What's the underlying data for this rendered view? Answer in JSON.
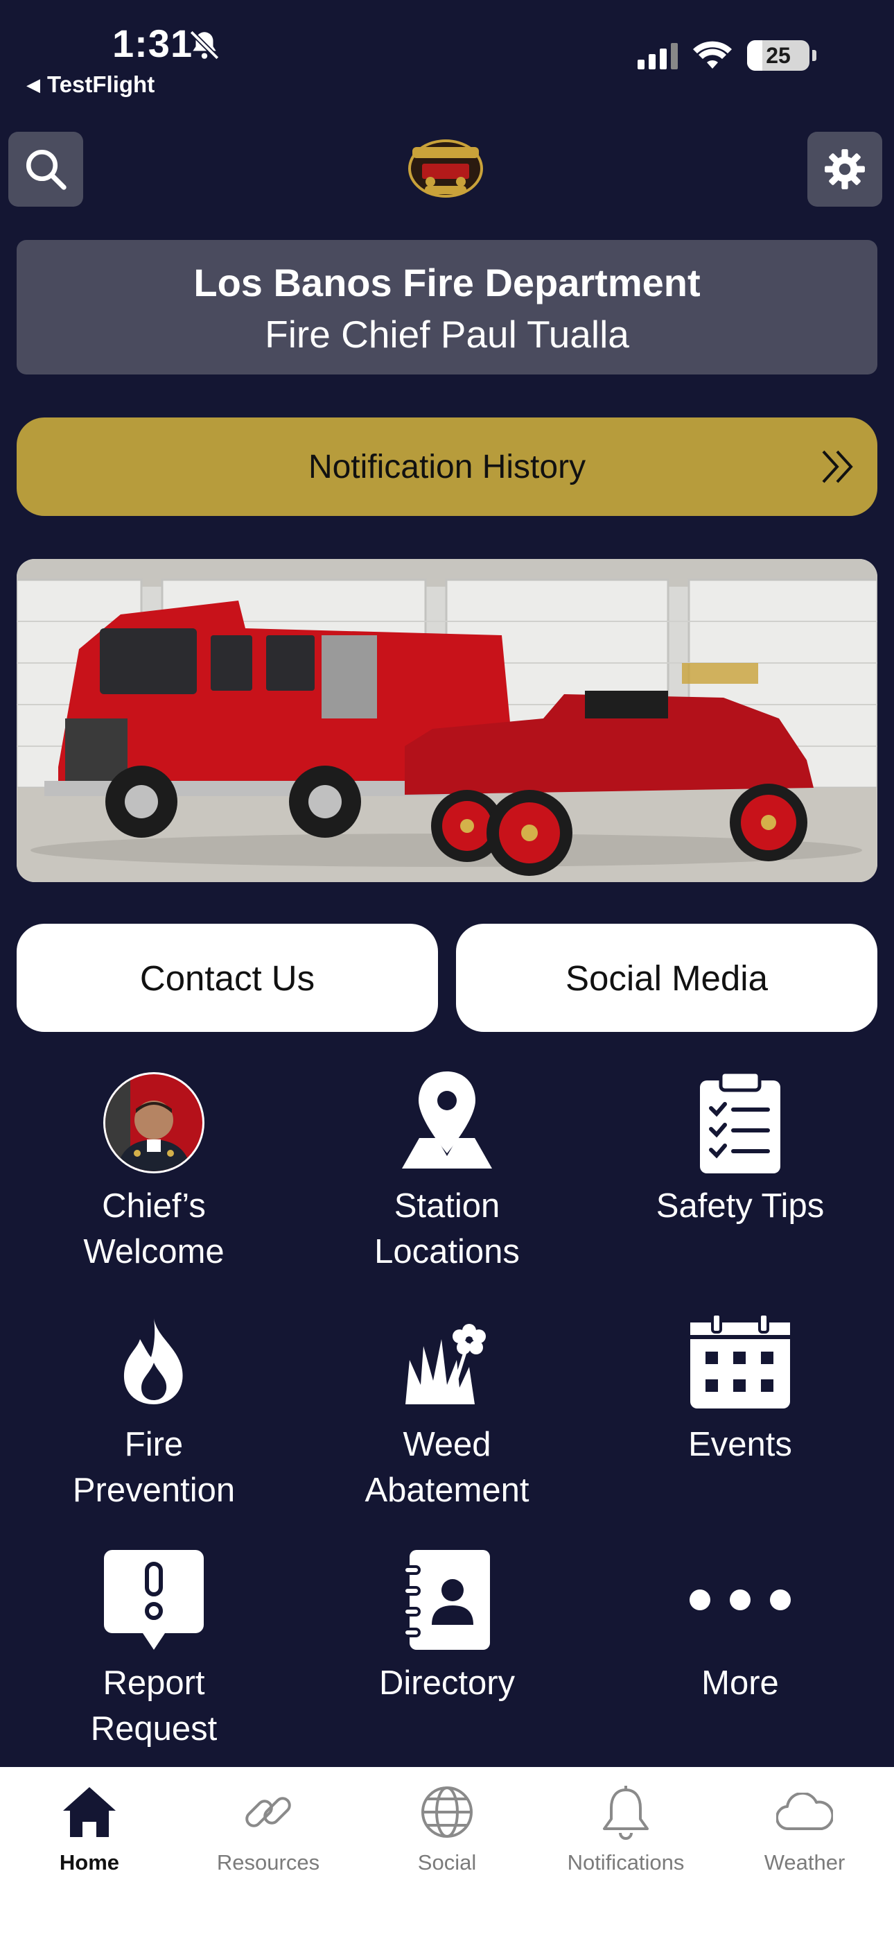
{
  "status_bar": {
    "time": "1:31",
    "back_app": "TestFlight",
    "battery": "25"
  },
  "header": {
    "title": "Los Banos Fire Department",
    "subtitle": "Fire Chief Paul Tualla",
    "logo_icon": "fire-dept-badge-logo"
  },
  "notification_button": {
    "label": "Notification History"
  },
  "actions": {
    "contact": "Contact Us",
    "social": "Social Media"
  },
  "tiles": [
    {
      "label": "Chief’s\nWelcome",
      "icon": "chief-photo"
    },
    {
      "label": "Station\nLocations",
      "icon": "map-pin-icon"
    },
    {
      "label": "Safety Tips",
      "icon": "checklist-icon"
    },
    {
      "label": "Fire\nPrevention",
      "icon": "flame-icon"
    },
    {
      "label": "Weed\nAbatement",
      "icon": "weeds-flower-icon"
    },
    {
      "label": "Events",
      "icon": "calendar-icon"
    },
    {
      "label": "Report\nRequest",
      "icon": "alert-bubble-icon"
    },
    {
      "label": "Directory",
      "icon": "contact-book-icon"
    },
    {
      "label": "More",
      "icon": "more-dots-icon"
    }
  ],
  "tabbar": [
    {
      "label": "Home",
      "active": true
    },
    {
      "label": "Resources",
      "active": false
    },
    {
      "label": "Social",
      "active": false
    },
    {
      "label": "Notifications",
      "active": false
    },
    {
      "label": "Weather",
      "active": false
    }
  ],
  "colors": {
    "background": "#141633",
    "card": "#4a4b5e",
    "accent_gold": "#b79c3c",
    "engine_red": "#c8121a"
  }
}
